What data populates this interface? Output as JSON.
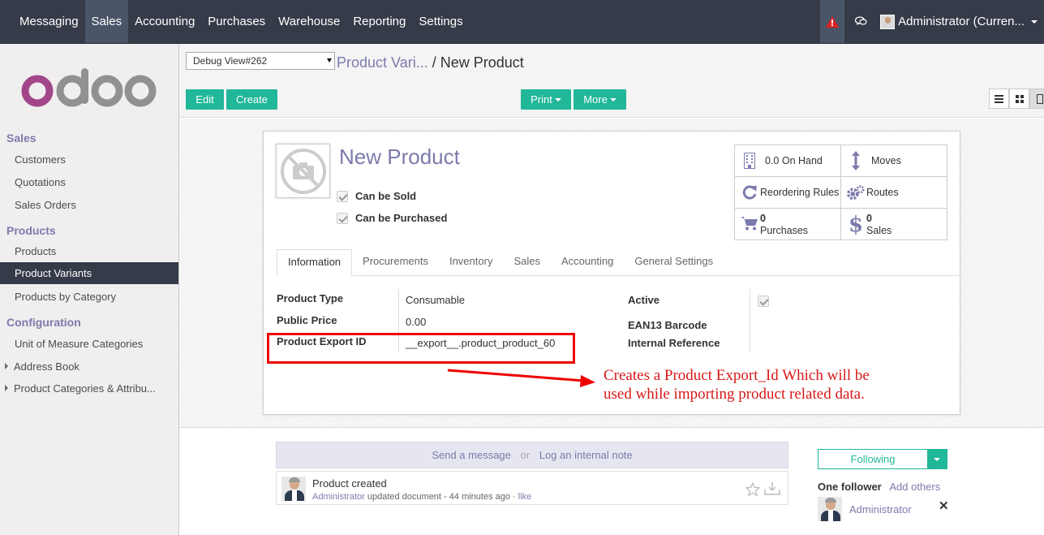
{
  "topbar": {
    "menu": [
      "Messaging",
      "Sales",
      "Accounting",
      "Purchases",
      "Warehouse",
      "Reporting",
      "Settings"
    ],
    "user": "Administrator (Curren..."
  },
  "sidebar": {
    "logo": "odoo",
    "sections": [
      {
        "title": "Sales",
        "items": [
          "Customers",
          "Quotations",
          "Sales Orders"
        ]
      },
      {
        "title": "Products",
        "items": [
          "Products",
          "Product Variants",
          "Products by Category"
        ]
      },
      {
        "title": "Configuration",
        "items": [
          "Unit of Measure Categories",
          "Address Book",
          "Product Categories & Attribu..."
        ]
      }
    ]
  },
  "control": {
    "debug": "Debug View#262",
    "crumb_parent": "Product Vari...",
    "crumb_sep": "/",
    "crumb_current": "New Product",
    "edit": "Edit",
    "create": "Create",
    "print": "Print",
    "more": "More"
  },
  "form": {
    "name": "New Product",
    "can_be_sold": "Can be Sold",
    "can_be_purchased": "Can be Purchased",
    "smart_buttons": [
      {
        "label": "0.0 On Hand",
        "icon": "building-icon"
      },
      {
        "label": "Moves",
        "icon": "arrows-v-icon"
      },
      {
        "label": "Reordering Rules",
        "icon": "refresh-icon"
      },
      {
        "label": "Routes",
        "icon": "cogs-icon"
      },
      {
        "value": "0",
        "label": "Purchases",
        "icon": "cart-icon"
      },
      {
        "value": "0",
        "label": "Sales",
        "icon": "dollar-icon"
      }
    ],
    "tabs": [
      "Information",
      "Procurements",
      "Inventory",
      "Sales",
      "Accounting",
      "General Settings"
    ],
    "fields_left": [
      {
        "label": "Product Type",
        "value": "Consumable"
      },
      {
        "label": "Public Price",
        "value": "0.00"
      },
      {
        "label": "Product Export ID",
        "value": "__export__.product_product_60"
      }
    ],
    "fields_right": [
      {
        "label": "Active"
      },
      {
        "label": "EAN13 Barcode"
      },
      {
        "label": "Internal Reference"
      }
    ]
  },
  "annotation": {
    "line1": "Creates a Product Export_Id Which will be",
    "line2": "used while importing product related data."
  },
  "chatter": {
    "send_message": "Send a message",
    "or": "or",
    "log_note": "Log an internal note",
    "msg_title": "Product created",
    "msg_author": "Administrator",
    "msg_action": "updated document",
    "msg_time": "44 minutes ago",
    "msg_like": "like",
    "following": "Following",
    "followers_count": "One follower",
    "add_others": "Add others",
    "follower_name": "Administrator"
  },
  "colors": {
    "brand": "#7c7bad",
    "primary_button": "#21b799",
    "navbar": "#353b48",
    "annotation": "#e00000"
  }
}
